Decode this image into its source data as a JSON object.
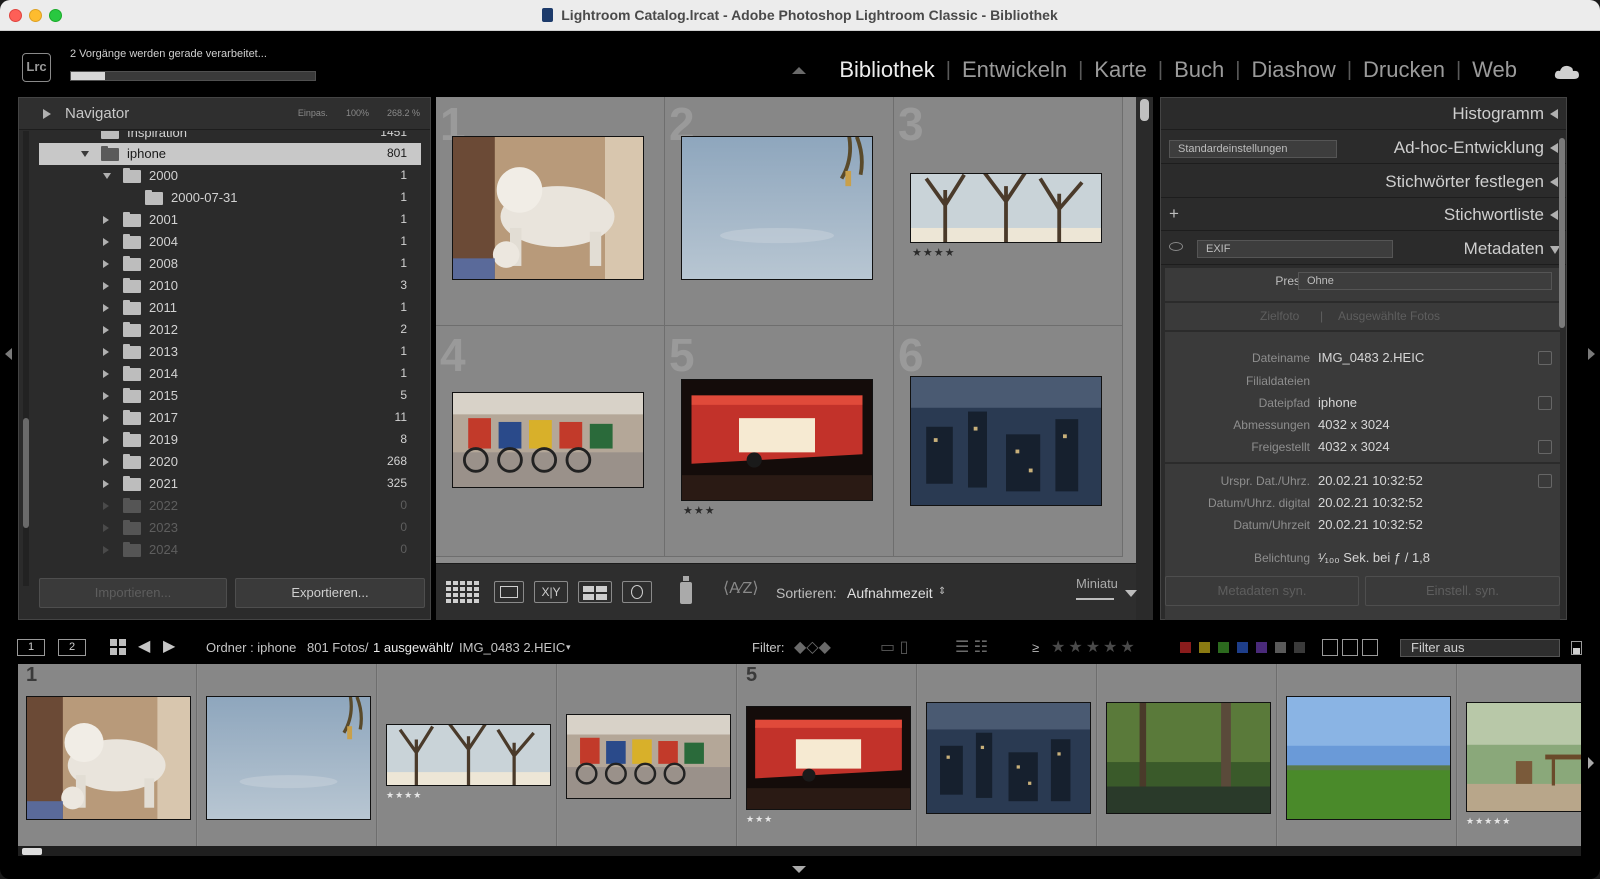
{
  "window": {
    "title": "Lightroom Catalog.lrcat - Adobe Photoshop Lightroom Classic - Bibliothek"
  },
  "identity": {
    "logo": "Lrc",
    "processing_text": "2 Vorgänge werden gerade verarbeitet...",
    "progress_fraction": 0.14,
    "modules": [
      "Bibliothek",
      "Entwickeln",
      "Karte",
      "Buch",
      "Diashow",
      "Drucken",
      "Web"
    ],
    "active_module": "Bibliothek",
    "cloud_icon": "cloud-icon"
  },
  "navigator": {
    "title": "Navigator",
    "zoom_options": [
      "Einpas.",
      "100%",
      "268.2 %"
    ]
  },
  "folders": [
    {
      "name": "Inspiration",
      "count": "1451",
      "level": 0,
      "state": "partial"
    },
    {
      "name": "iphone",
      "count": "801",
      "level": 0,
      "state": "open",
      "selected": true
    },
    {
      "name": "2000",
      "count": "1",
      "level": 1,
      "state": "open"
    },
    {
      "name": "2000-07-31",
      "count": "1",
      "level": 2,
      "state": "none"
    },
    {
      "name": "2001",
      "count": "1",
      "level": 1,
      "state": "closed"
    },
    {
      "name": "2004",
      "count": "1",
      "level": 1,
      "state": "closed"
    },
    {
      "name": "2008",
      "count": "1",
      "level": 1,
      "state": "closed"
    },
    {
      "name": "2010",
      "count": "3",
      "level": 1,
      "state": "closed"
    },
    {
      "name": "2011",
      "count": "1",
      "level": 1,
      "state": "closed"
    },
    {
      "name": "2012",
      "count": "2",
      "level": 1,
      "state": "closed"
    },
    {
      "name": "2013",
      "count": "1",
      "level": 1,
      "state": "closed"
    },
    {
      "name": "2014",
      "count": "1",
      "level": 1,
      "state": "closed"
    },
    {
      "name": "2015",
      "count": "5",
      "level": 1,
      "state": "closed"
    },
    {
      "name": "2017",
      "count": "11",
      "level": 1,
      "state": "closed"
    },
    {
      "name": "2019",
      "count": "8",
      "level": 1,
      "state": "closed"
    },
    {
      "name": "2020",
      "count": "268",
      "level": 1,
      "state": "closed"
    },
    {
      "name": "2021",
      "count": "325",
      "level": 1,
      "state": "closed"
    },
    {
      "name": "2022",
      "count": "0",
      "level": 1,
      "state": "closed",
      "dim": true
    },
    {
      "name": "2023",
      "count": "0",
      "level": 1,
      "state": "closed",
      "dim": true
    },
    {
      "name": "2024",
      "count": "0",
      "level": 1,
      "state": "closed",
      "dim": true
    }
  ],
  "left_buttons": {
    "import": "Importieren...",
    "export": "Exportieren..."
  },
  "grid": {
    "cells": [
      {
        "num": "1",
        "stars": "",
        "subject": "lion-statue"
      },
      {
        "num": "2",
        "stars": "",
        "subject": "sky-branch"
      },
      {
        "num": "3",
        "stars": "★★★★",
        "subject": "winter-trees"
      },
      {
        "num": "4",
        "stars": "",
        "subject": "rickshaws"
      },
      {
        "num": "5",
        "stars": "★★★",
        "subject": "night-stall"
      },
      {
        "num": "6",
        "stars": "",
        "subject": "city-night"
      }
    ]
  },
  "toolbar": {
    "sort_label": "Sortieren:",
    "sort_value": "Aufnahmezeit",
    "thumbs_label": "Miniatu",
    "icons": [
      "grid-view-icon",
      "loupe-view-icon",
      "compare-view-icon",
      "survey-view-icon",
      "people-view-icon",
      "spray-can-icon",
      "sort-direction-icon"
    ]
  },
  "right_panel": {
    "histogram": "Histogramm",
    "quick_develop": "Ad-hoc-Entwicklung",
    "quick_develop_preset": "Standardeinstellungen",
    "keywording": "Stichwörter festlegen",
    "keyword_list": "Stichwortliste",
    "metadata": "Metadaten",
    "metadata_view": "EXIF",
    "preset_label": "Preset",
    "preset_value": "Ohne",
    "target_photo": "Zielfoto",
    "selected_photos": "Ausgewählte Fotos",
    "fields": [
      {
        "label": "Dateiname",
        "value": "IMG_0483 2.HEIC"
      },
      {
        "label": "Filialdateien",
        "value": ""
      },
      {
        "label": "Dateipfad",
        "value": "iphone"
      },
      {
        "label": "Abmessungen",
        "value": "4032 x 3024"
      },
      {
        "label": "Freigestellt",
        "value": "4032 x 3024"
      },
      {
        "label": "Urspr. Dat./Uhrz.",
        "value": "20.02.21 10:32:52"
      },
      {
        "label": "Datum/Uhrz. digital",
        "value": "20.02.21 10:32:52"
      },
      {
        "label": "Datum/Uhrzeit",
        "value": "20.02.21 10:32:52"
      },
      {
        "label": "Belichtung",
        "value": "¹⁄₁₀₀ Sek. bei ƒ / 1,8"
      }
    ],
    "sync_metadata": "Metadaten syn.",
    "sync_settings": "Einstell. syn."
  },
  "filterbar": {
    "page1": "1",
    "page2": "2",
    "source": "Ordner : iphone",
    "count": "801 Fotos/",
    "selected": "1 ausgewählt/",
    "filename": "IMG_0483 2.HEIC",
    "filter_label": "Filter:",
    "gte": "≥",
    "rating_stars": "★★★★★",
    "filter_value": "Filter aus",
    "color_labels": [
      "#8a1c1c",
      "#8a7a12",
      "#2c6a1e",
      "#1e3e8a",
      "#4a2a7a",
      "#5a5a5a",
      "#3a3a3a"
    ]
  },
  "filmstrip": [
    {
      "num": "1",
      "stars": "",
      "subject": "lion-statue"
    },
    {
      "num": "",
      "stars": "",
      "subject": "sky-branch"
    },
    {
      "num": "",
      "stars": "★★★★",
      "subject": "winter-trees"
    },
    {
      "num": "",
      "stars": "",
      "subject": "rickshaws"
    },
    {
      "num": "5",
      "stars": "★★★",
      "subject": "night-stall"
    },
    {
      "num": "",
      "stars": "",
      "subject": "city-night"
    },
    {
      "num": "",
      "stars": "",
      "subject": "forest-pond"
    },
    {
      "num": "",
      "stars": "",
      "subject": "green-field"
    },
    {
      "num": "",
      "stars": "★★★★★",
      "subject": "garden-table"
    }
  ]
}
